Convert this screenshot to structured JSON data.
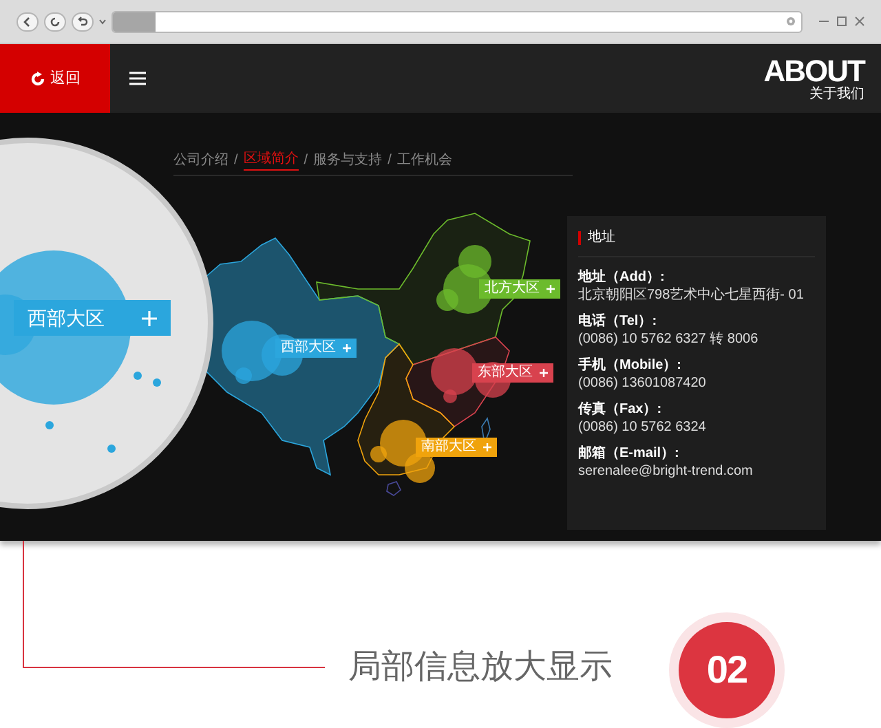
{
  "header": {
    "back_button": "返回",
    "logo": "ABOUT",
    "logo_subtitle": "关于我们"
  },
  "breadcrumb": [
    {
      "label": "公司介绍",
      "selected": false
    },
    {
      "label": "区域简介",
      "selected": true
    },
    {
      "label": "服务与支持",
      "selected": false
    },
    {
      "label": "工作机会",
      "selected": false
    }
  ],
  "breadcrumb_separator": "/",
  "map": {
    "regions": [
      {
        "kind": "west",
        "label": "西部大区",
        "color": "#2ba6dd"
      },
      {
        "kind": "north",
        "label": "北方大区",
        "color": "#6cbb2c"
      },
      {
        "kind": "east",
        "label": "东部大区",
        "color": "#d8424e"
      },
      {
        "kind": "south",
        "label": "南部大区",
        "color": "#f0a30c"
      }
    ]
  },
  "info_panel": {
    "title": "地址",
    "entries": [
      {
        "label": "地址（Add）:",
        "value": "北京朝阳区798艺术中心七星西街- 01"
      },
      {
        "label": "电话（Tel）:",
        "value": "(0086) 10 5762 6327 转 8006"
      },
      {
        "label": "手机（Mobile）:",
        "value": "(0086) 13601087420"
      },
      {
        "label": "传真（Fax）:",
        "value": "(0086) 10 5762 6324"
      },
      {
        "label": "邮箱（E-mail）:",
        "value": "serenalee@bright-trend.com"
      }
    ]
  },
  "magnifier": {
    "label": "西部大区"
  },
  "caption": {
    "text": "局部信息放大显示",
    "badge": "02"
  }
}
